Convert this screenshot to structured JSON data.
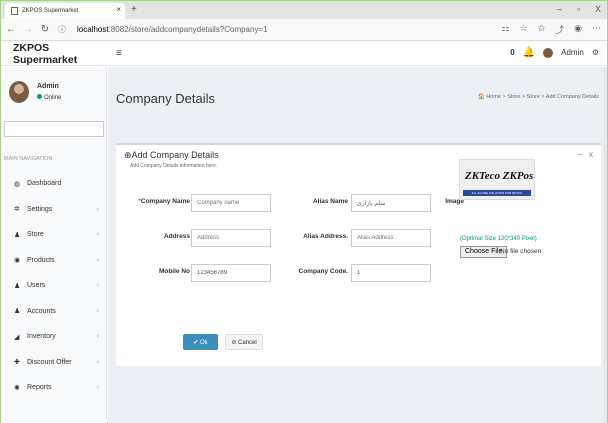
{
  "browser": {
    "tab_title": "ZKPOS Supermarket",
    "tab_close": "×",
    "new_tab": "+",
    "url_host": "localhost",
    "url_path": ":8082/store/addcompanydetails?Company=1",
    "win_min": "–",
    "win_max": "▫",
    "win_close": "X"
  },
  "app": {
    "brand": "ZKPOS Supermarket",
    "menu_toggle": "≡",
    "admin_label": "Admin",
    "notif_count": "0"
  },
  "sidebar": {
    "user_name": "Admin",
    "user_status": "Online",
    "main_nav_label": "MAIN NAVIGATION",
    "items": [
      {
        "label": "Dashboard",
        "icon": "dashboard-icon",
        "glyph": "◍",
        "chev": ""
      },
      {
        "label": "Settings",
        "icon": "gear-icon",
        "glyph": "✲",
        "chev": "‹"
      },
      {
        "label": "Store",
        "icon": "store-icon",
        "glyph": "♟",
        "chev": "‹"
      },
      {
        "label": "Products",
        "icon": "products-icon",
        "glyph": "◉",
        "chev": "‹"
      },
      {
        "label": "Users",
        "icon": "users-icon",
        "glyph": "♟",
        "chev": "‹"
      },
      {
        "label": "Accounts",
        "icon": "accounts-icon",
        "glyph": "♟",
        "chev": "‹"
      },
      {
        "label": "Inventory",
        "icon": "inventory-icon",
        "glyph": "◢",
        "chev": "‹"
      },
      {
        "label": "Discount Offer",
        "icon": "plus-icon",
        "glyph": "✚",
        "chev": "‹"
      },
      {
        "label": "Reports",
        "icon": "reports-icon",
        "glyph": "✺",
        "chev": "‹"
      }
    ]
  },
  "page": {
    "title": "Company Details",
    "breadcrumb": "🏠 Home > Store > Store > Add Company Details"
  },
  "form": {
    "box_title": "Add Company Details",
    "box_subtitle": "Add Company Details information here.",
    "collapse": "–",
    "close": "x",
    "required_mark": "*",
    "company_name_label": "Company Name",
    "company_name_placeholder": "Company name",
    "alias_name_label": "Alias Name",
    "alias_name_value": "سلم بازاری",
    "image_label": "Image",
    "address_label": "Address",
    "address_placeholder": "Address",
    "alias_address_label": "Alias Address.",
    "alias_address_placeholder": "Alias Address",
    "mobile_label": "Mobile No",
    "mobile_value": "123456789",
    "company_code_label": "Company Code.",
    "company_code_value": "1",
    "logo_text": "ZKTeco ZKPos",
    "logo_tagline": "ALL IN ONE SOLUTION FOR RETAIL",
    "optimal_size": "(Optimal Size 120*340 Pixel)",
    "choose_file": "Choose File",
    "no_file": "No file chosen",
    "ok_label": "✔ Ok",
    "cancel_label": "⊘ Cancel"
  },
  "colors": {
    "primary": "#3c8dbc",
    "success": "#00a65a",
    "danger": "#dd4b39",
    "warning": "#f39c12"
  }
}
